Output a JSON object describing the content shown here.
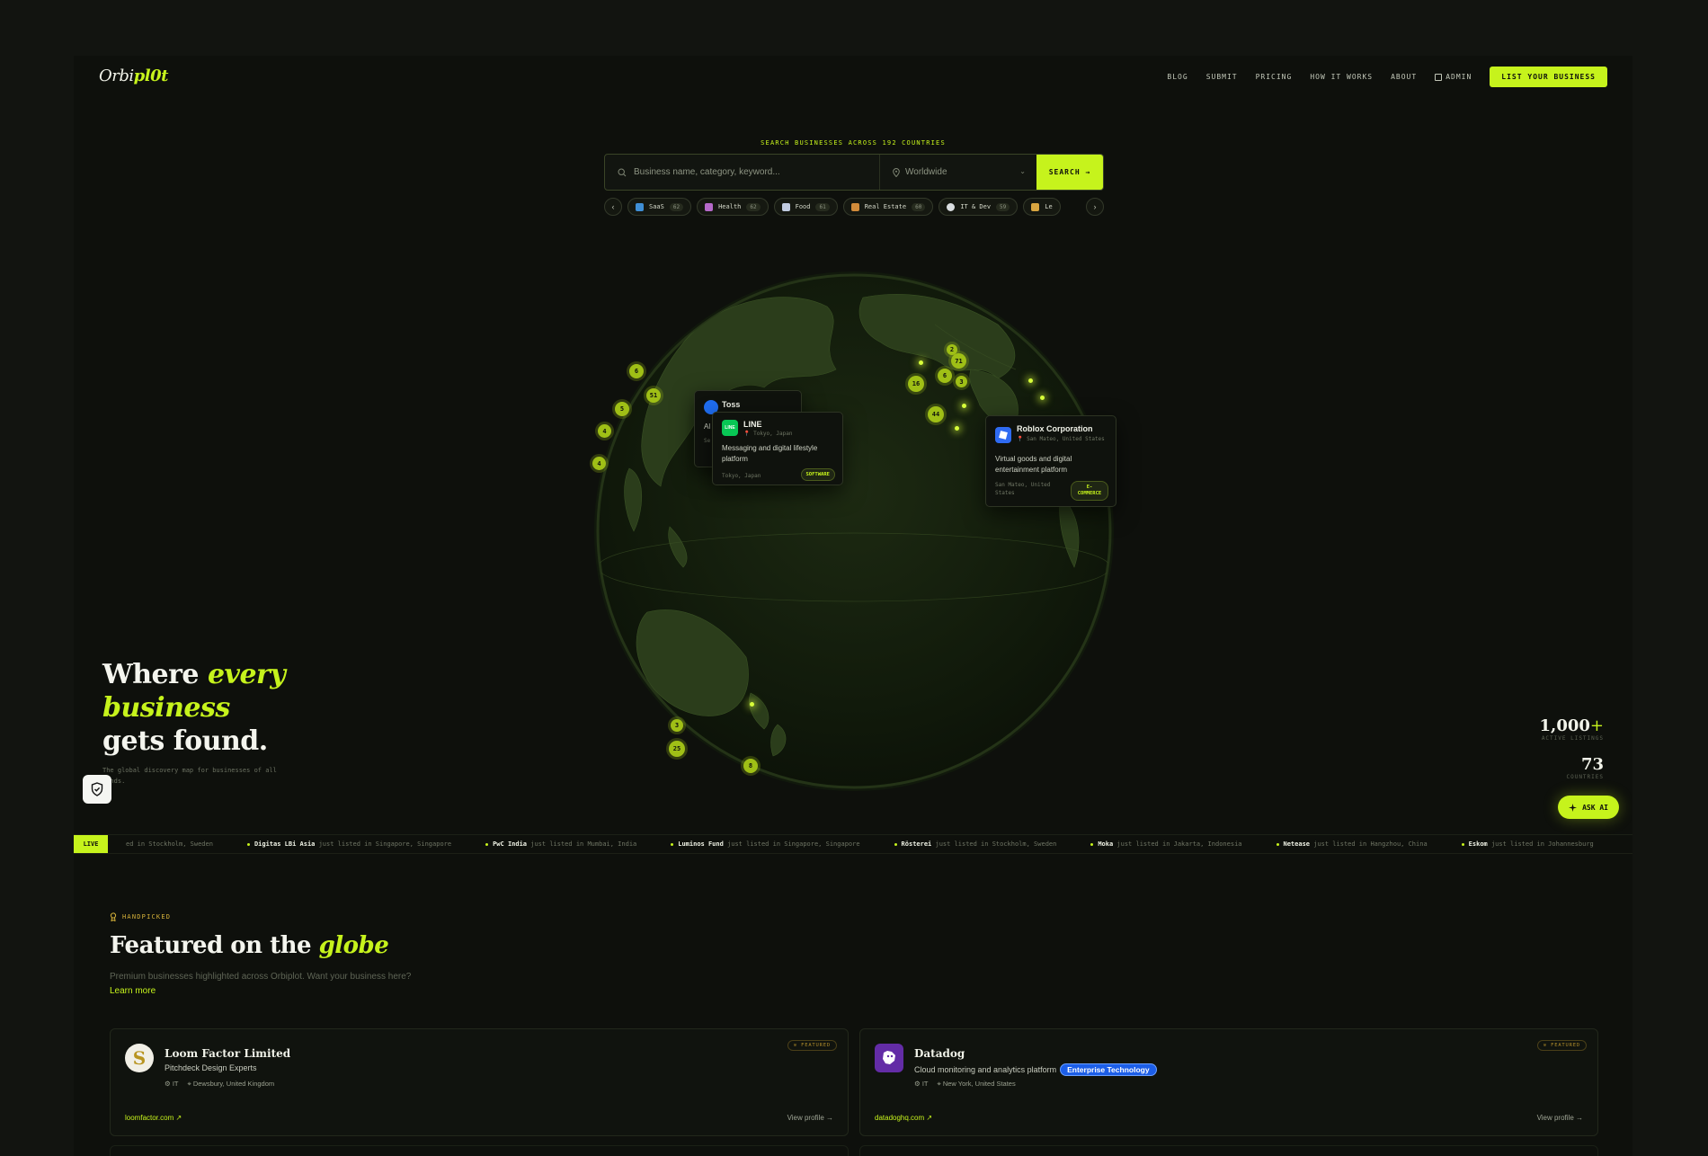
{
  "brand": {
    "logo_a": "Orbi",
    "logo_b": "pl0t"
  },
  "nav": {
    "blog": "BLOG",
    "submit": "SUBMIT",
    "pricing": "PRICING",
    "how": "HOW IT WORKS",
    "about": "ABOUT",
    "admin": "ADMIN",
    "cta": "LIST YOUR BUSINESS"
  },
  "search": {
    "kicker": "SEARCH BUSINESSES ACROSS 192 COUNTRIES",
    "placeholder": "Business name, category, keyword...",
    "location": "Worldwide",
    "button": "SEARCH →"
  },
  "categories": [
    {
      "label": "SaaS",
      "count": "62",
      "color": "#3f8fd6"
    },
    {
      "label": "Health",
      "count": "62",
      "color": "#b569c9"
    },
    {
      "label": "Food",
      "count": "61",
      "color": "#c0cbe0"
    },
    {
      "label": "Real Estate",
      "count": "60",
      "color": "#d18b3a"
    },
    {
      "label": "IT & Dev",
      "count": "59",
      "color": "#d9dde0"
    },
    {
      "label": "Le",
      "count": "",
      "color": "#d8a540"
    }
  ],
  "clusters": [
    "6",
    "51",
    "5",
    "4",
    "4",
    "16",
    "6",
    "71",
    "3",
    "2",
    "44",
    "3",
    "25",
    "8"
  ],
  "globe_cards": {
    "toss": {
      "name": "Toss",
      "frag_a": "Al",
      "frag_b": "Se"
    },
    "line": {
      "logo": "LINE",
      "name": "LINE",
      "loc": "📍 Tokyo, Japan",
      "desc": "Messaging and digital lifestyle platform",
      "foot": "Tokyo, Japan",
      "tag": "SOFTWARE"
    },
    "roblox": {
      "name": "Roblox Corporation",
      "loc": "📍 San Mateo, United States",
      "desc": "Virtual goods and digital entertainment platform",
      "foot": "San Mateo, United States",
      "tag": "E-COMMERCE"
    }
  },
  "hero": {
    "l1a": "Where ",
    "l1b": "every",
    "l2": "business",
    "l3": "gets found.",
    "sub": "The global discovery map for businesses of all kinds."
  },
  "stats": {
    "listings": "1,000",
    "listings_plus": "+",
    "listings_label": "ACTIVE LISTINGS",
    "countries": "73",
    "countries_label": "COUNTRIES"
  },
  "ask_ai": "ASK AI",
  "ticker": {
    "live": "LIVE",
    "lead": "ed in Stockholm, Sweden",
    "items": [
      {
        "name": "Digitas LBi Asia",
        "rest": " just listed in Singapore, Singapore"
      },
      {
        "name": "PwC India",
        "rest": " just listed in Mumbai, India"
      },
      {
        "name": "Luminos Fund",
        "rest": " just listed in Singapore, Singapore"
      },
      {
        "name": "Rösterei",
        "rest": " just listed in Stockholm, Sweden"
      },
      {
        "name": "Moka",
        "rest": " just listed in Jakarta, Indonesia"
      },
      {
        "name": "Netease",
        "rest": " just listed in Hangzhou, China"
      },
      {
        "name": "Eskom",
        "rest": " just listed in Johannesburg"
      }
    ]
  },
  "featured": {
    "kicker": "HANDPICKED",
    "title_a": "Featured on the ",
    "title_b": "globe",
    "sub": "Premium businesses highlighted across Orbiplot. Want your business here?",
    "learn": "Learn more",
    "badge": "⊙ FEATURED",
    "view": "View profile →",
    "cards": [
      {
        "name": "Loom Factor Limited",
        "tagline": "Pitchdeck Design Experts",
        "cat": "IT",
        "loc": "Dewsbury, United Kingdom",
        "site": "loomfactor.com ↗",
        "badge": ""
      },
      {
        "name": "Datadog",
        "tagline": "Cloud monitoring and analytics platform",
        "cat": "IT",
        "loc": "New York, United States",
        "site": "datadoghq.com ↗",
        "badge": "Enterprise Technology"
      }
    ]
  },
  "colors": {
    "accent": "#c6f31c",
    "bg": "#0e100c",
    "gold": "#d6b23a"
  }
}
